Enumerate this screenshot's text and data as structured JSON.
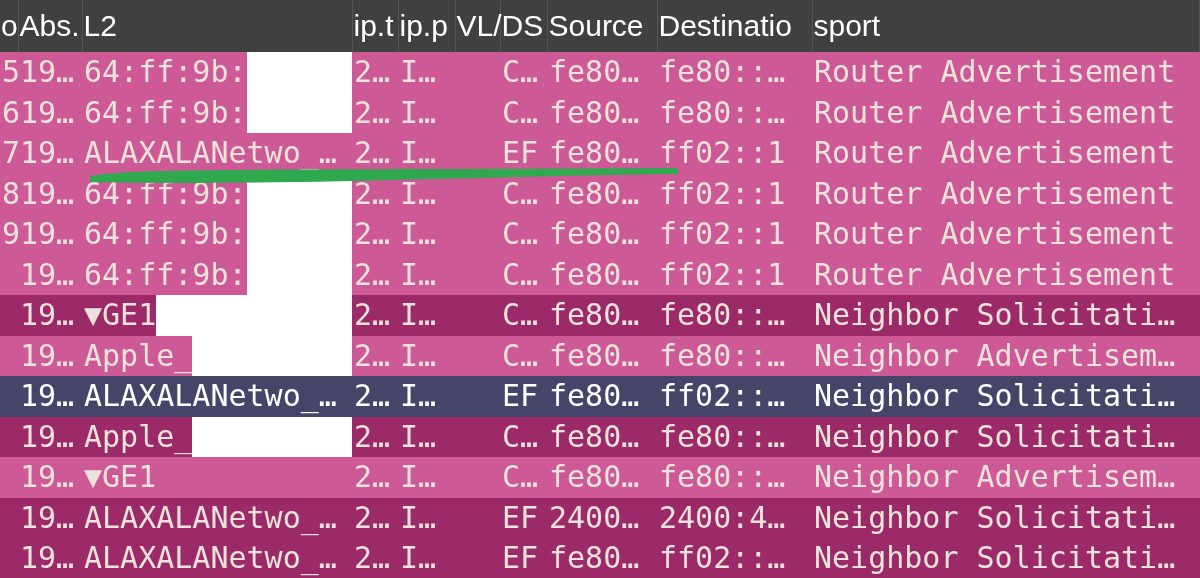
{
  "columns": [
    {
      "label": "o"
    },
    {
      "label": "Abs."
    },
    {
      "label": "L2"
    },
    {
      "label": "ip.t"
    },
    {
      "label": "ip.p"
    },
    {
      "label": "VL/"
    },
    {
      "label": "DS"
    },
    {
      "label": "Source"
    },
    {
      "label": "Destinatio"
    },
    {
      "label": "sport"
    }
  ],
  "rows": [
    {
      "color": "#cd5a96",
      "selected": false,
      "redacted": true,
      "column_1": "5",
      "abs": "19…",
      "l2": "64:ff:9b:",
      "ip_t": "2…",
      "ip_p": "I…",
      "ds": "C…",
      "source": "fe80…",
      "destination": "fe80::…",
      "info": "Router Advertisement"
    },
    {
      "color": "#cd5a96",
      "selected": false,
      "redacted": true,
      "column_1": "6",
      "abs": "19…",
      "l2": "64:ff:9b:",
      "ip_t": "2…",
      "ip_p": "I…",
      "ds": "C…",
      "source": "fe80…",
      "destination": "fe80::…",
      "info": "Router Advertisement"
    },
    {
      "color": "#cd5a96",
      "selected": false,
      "redacted": false,
      "column_1": "7",
      "abs": "19…",
      "l2": "ALAXALANetwo_…",
      "ip_t": "2…",
      "ip_p": "I…",
      "ds": "EF",
      "source": "fe80…",
      "destination": "ff02::1",
      "info": "Router Advertisement"
    },
    {
      "color": "#cd5a96",
      "selected": false,
      "redacted": true,
      "column_1": "8",
      "abs": "19…",
      "l2": "64:ff:9b:",
      "ip_t": "2…",
      "ip_p": "I…",
      "ds": "C…",
      "source": "fe80…",
      "destination": "ff02::1",
      "info": "Router Advertisement"
    },
    {
      "color": "#cd5a96",
      "selected": false,
      "redacted": true,
      "column_1": "9",
      "abs": "19…",
      "l2": "64:ff:9b:",
      "ip_t": "2…",
      "ip_p": "I…",
      "ds": "C…",
      "source": "fe80…",
      "destination": "ff02::1",
      "info": "Router Advertisement"
    },
    {
      "color": "#cd5a96",
      "selected": false,
      "redacted": true,
      "abs": "19…",
      "l2": "64:ff:9b:",
      "ip_t": "2…",
      "ip_p": "I…",
      "ds": "C…",
      "source": "fe80…",
      "destination": "ff02::1",
      "info": "Router Advertisement"
    },
    {
      "color": "#9c2a68",
      "selected": false,
      "redacted": true,
      "abs": "19…",
      "l2": "▼GE1",
      "ip_t": "2…",
      "ip_p": "I…",
      "ds": "C…",
      "source": "fe80…",
      "destination": "fe80::…",
      "info": "Neighbor Solicitati…"
    },
    {
      "color": "#cd5a96",
      "selected": false,
      "redacted": true,
      "abs": "19…",
      "l2": "Apple_",
      "ip_t": "2…",
      "ip_p": "I…",
      "ds": "C…",
      "source": "fe80…",
      "destination": "fe80::…",
      "info": "Neighbor Advertisem…"
    },
    {
      "color": "#45456a",
      "selected": true,
      "redacted": false,
      "abs": "19…",
      "l2": "ALAXALANetwo_…",
      "ip_t": "2…",
      "ip_p": "I…",
      "ds": "EF",
      "source": "fe80…",
      "destination": "ff02::…",
      "info": "Neighbor Solicitati…"
    },
    {
      "color": "#9c2a68",
      "selected": false,
      "redacted": true,
      "abs": "19…",
      "l2": "Apple_",
      "ip_t": "2…",
      "ip_p": "I…",
      "ds": "C…",
      "source": "fe80…",
      "destination": "fe80::…",
      "info": "Neighbor Solicitati…"
    },
    {
      "color": "#cd5a96",
      "selected": false,
      "redacted": false,
      "abs": "19…",
      "l2": "▼GE1",
      "ip_t": "2…",
      "ip_p": "I…",
      "ds": "C…",
      "source": "fe80…",
      "destination": "fe80::…",
      "info": "Neighbor Advertisem…"
    },
    {
      "color": "#9c2a68",
      "selected": false,
      "redacted": false,
      "abs": "19…",
      "l2": "ALAXALANetwo_…",
      "ip_t": "2…",
      "ip_p": "I…",
      "ds": "EF",
      "source": "2400…",
      "destination": "2400:4…",
      "info": "Neighbor Solicitati…"
    },
    {
      "color": "#9c2a68",
      "selected": false,
      "redacted": false,
      "abs": "19…",
      "l2": "ALAXALANetwo_…",
      "ip_t": "2…",
      "ip_p": "I…",
      "ds": "EF",
      "source": "fe80…",
      "destination": "ff02::…",
      "info": "Neighbor Solicitati…"
    }
  ]
}
